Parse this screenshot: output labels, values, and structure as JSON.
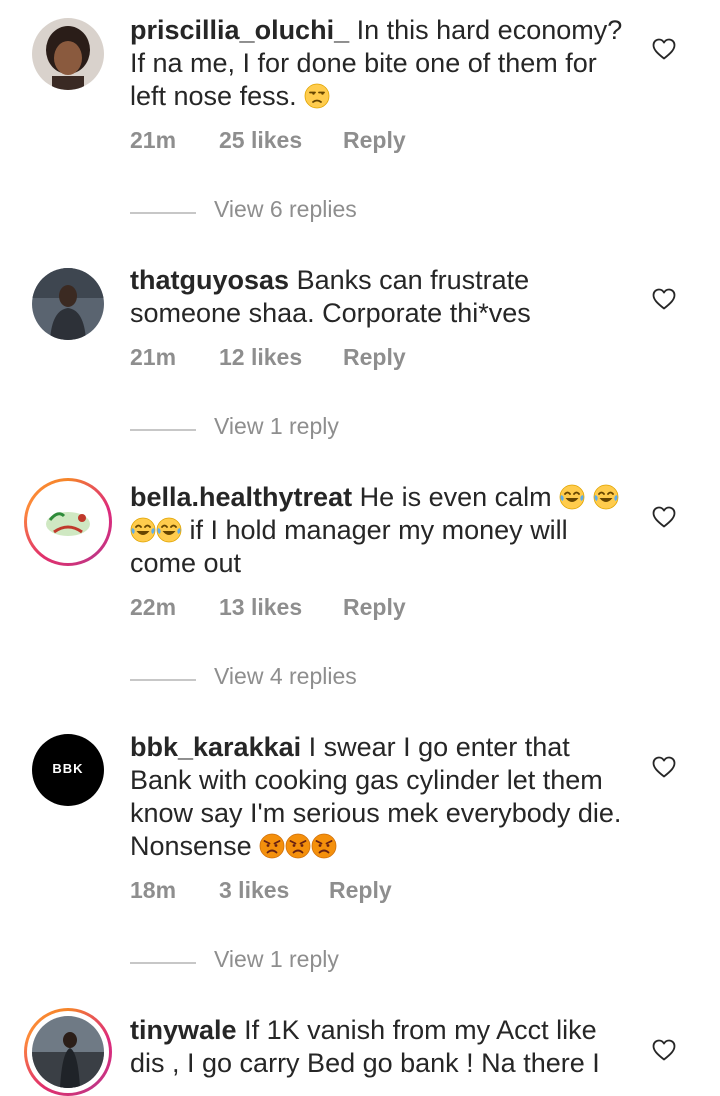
{
  "comments": [
    {
      "username": "priscillia_oluchi_",
      "text": "In this hard economy? If na me, I for done bite one of them for left nose fess.",
      "time": "21m",
      "likes": "25 likes",
      "reply": "Reply",
      "view_replies": "View 6 replies"
    },
    {
      "username": "thatguyosas",
      "text": "Banks can frustrate someone shaa. Corporate thi*ves",
      "time": "21m",
      "likes": "12 likes",
      "reply": "Reply",
      "view_replies": "View 1 reply"
    },
    {
      "username": "bella.healthytreat",
      "text1": "He is even calm",
      "text2": "if I hold manager my money",
      "text3": "will come out",
      "time": "22m",
      "likes": "13 likes",
      "reply": "Reply",
      "view_replies": "View 4 replies"
    },
    {
      "username": "bbk_karakkai",
      "avatar_text": "BBK",
      "text": "I swear I go enter that Bank with cooking gas cylinder let them know say I'm serious mek everybody die. Nonsense",
      "time": "18m",
      "likes": "3 likes",
      "reply": "Reply",
      "view_replies": "View 1 reply"
    },
    {
      "username": "tinywale",
      "text": "If 1K vanish from my Acct like dis , I go carry Bed go bank ! Na there I"
    }
  ],
  "icons": {
    "heart": "heart-outline-icon"
  },
  "colors": {
    "text": "#262626",
    "meta": "#8e8e8e",
    "divider": "#c7c7c7"
  }
}
